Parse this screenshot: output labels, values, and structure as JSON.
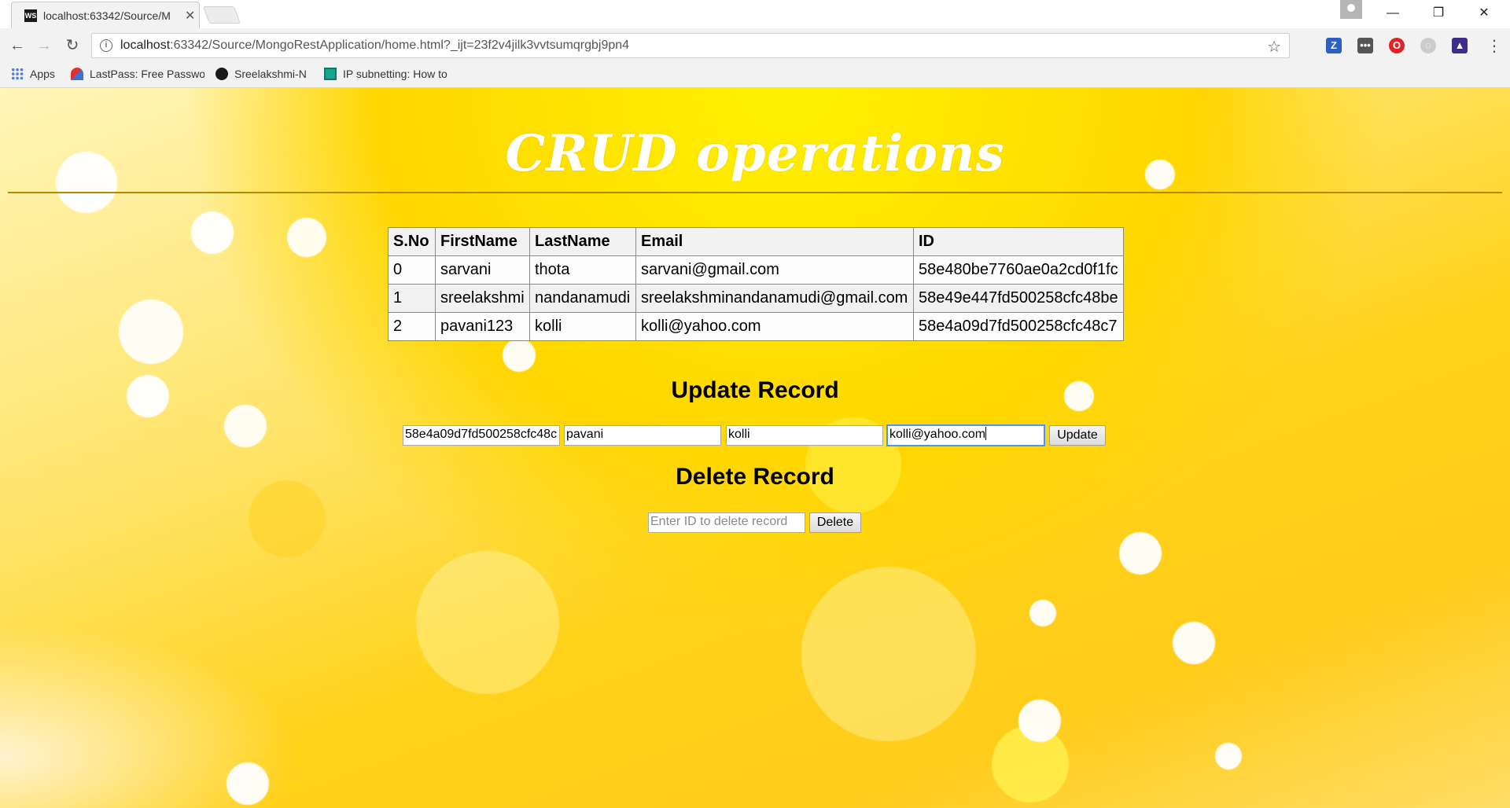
{
  "browser": {
    "tab_title": "localhost:63342/Source/M",
    "tab_favicon_text": "WS",
    "url_host": "localhost",
    "url_rest": ":63342/Source/MongoRestApplication/home.html?_ijt=23f2v4jilk3vvtsumqrgbj9pn4",
    "bookmarks": [
      {
        "label": "Apps",
        "icon": "apps-grid-icon"
      },
      {
        "label": "LastPass: Free Passwo",
        "icon": "lastpass-icon"
      },
      {
        "label": "Sreelakshmi-N",
        "icon": "github-icon"
      },
      {
        "label": "IP subnetting: How to",
        "icon": "bookmark-page-icon"
      }
    ],
    "extensions": [
      {
        "icon": "z-extension-icon",
        "text": "Z",
        "color": "#2d5fc4"
      },
      {
        "icon": "dots-extension-icon",
        "text": "•••",
        "color": "#555555"
      },
      {
        "icon": "opera-extension-icon",
        "text": "O",
        "color": "#e02424"
      },
      {
        "icon": "circle-extension-icon",
        "text": "◌",
        "color": "#cccccc"
      },
      {
        "icon": "tool-extension-icon",
        "text": "▲",
        "color": "#3a2e8a"
      }
    ]
  },
  "page": {
    "title": "CRUD operations",
    "table": {
      "headers": [
        "S.No",
        "FirstName",
        "LastName",
        "Email",
        "ID"
      ],
      "rows": [
        [
          "0",
          "sarvani",
          "thota",
          "sarvani@gmail.com",
          "58e480be7760ae0a2cd0f1fc"
        ],
        [
          "1",
          "sreelakshmi",
          "nandanamudi",
          "sreelakshminandanamudi@gmail.com",
          "58e49e447fd500258cfc48be"
        ],
        [
          "2",
          "pavani123",
          "kolli",
          "kolli@yahoo.com",
          "58e4a09d7fd500258cfc48c7"
        ]
      ]
    },
    "update": {
      "heading": "Update Record",
      "id_value": "58e4a09d7fd500258cfc48c",
      "firstname_value": "pavani",
      "lastname_value": "kolli",
      "email_value": "kolli@yahoo.com",
      "button_label": "Update"
    },
    "delete": {
      "heading": "Delete Record",
      "id_placeholder": "Enter ID to delete record",
      "button_label": "Delete"
    }
  }
}
